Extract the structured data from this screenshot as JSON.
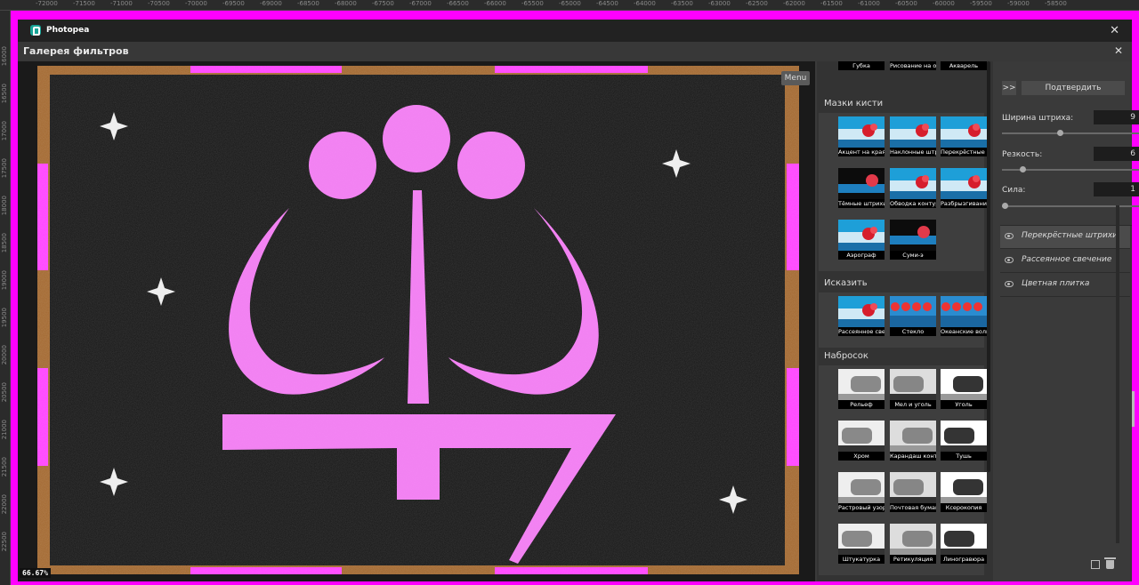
{
  "app": {
    "title": "Photopea",
    "logo_icon": "photopea-logo-icon"
  },
  "ruler": {
    "top_ticks": [
      "-72000",
      "-71500",
      "-71000",
      "-70500",
      "-70000",
      "-69500",
      "-69000",
      "-68500",
      "-68000",
      "-67500",
      "-67000",
      "-66500",
      "-66000",
      "-65500",
      "-65000",
      "-64500",
      "-64000",
      "-63500",
      "-63000",
      "-62500",
      "-62000",
      "-61500",
      "-61000",
      "-60500",
      "-60000",
      "-59500",
      "-59000",
      "-58500"
    ],
    "left_ticks": [
      "16000",
      "16500",
      "17000",
      "17500",
      "18000",
      "18500",
      "19000",
      "19500",
      "20000",
      "20500",
      "21000",
      "21500",
      "22000",
      "22500"
    ]
  },
  "dialog": {
    "title": "Галерея фильтров",
    "close_icon": "close-icon"
  },
  "preview": {
    "menu_label": "Menu",
    "zoom": "66.67%"
  },
  "library": {
    "top_row": [
      "Губка",
      "Рисование на обороте",
      "Акварель"
    ],
    "sections": [
      {
        "title": "Мазки кисти",
        "items": [
          "Акцент на краях",
          "Наклонные штрихи",
          "Перекрёстные штрихи",
          "Тёмные штрихи",
          "Обводка контура",
          "Разбрызгивание",
          "Аэрограф",
          "Суми-э"
        ]
      },
      {
        "title": "Исказить",
        "items": [
          "Рассеянное свечение",
          "Стекло",
          "Океанские волны"
        ]
      },
      {
        "title": "Набросок",
        "items": [
          "Рельеф",
          "Мел и уголь",
          "Уголь",
          "Хром",
          "Карандаш контур",
          "Тушь",
          "Растровый узор",
          "Почтовая бумага",
          "Ксерокопия",
          "Штукатурка",
          "Ретикуляция",
          "Линогравюра"
        ]
      }
    ]
  },
  "settings": {
    "expand_label": ">>",
    "confirm_label": "Подтвердить",
    "params": [
      {
        "label": "Ширина штриха:",
        "value": "9",
        "fraction": 0.44
      },
      {
        "label": "Резкость:",
        "value": "6",
        "fraction": 0.14
      },
      {
        "label": "Сила:",
        "value": "1",
        "fraction": 0.0
      }
    ],
    "layers": [
      {
        "name": "Перекрёстные штрихи",
        "active": true,
        "icon": "eye-icon"
      },
      {
        "name": "Рассеянное свечение",
        "active": false,
        "icon": "eye-icon"
      },
      {
        "name": "Цветная плитка",
        "active": false,
        "icon": "eye-icon"
      }
    ],
    "new_layer_icon": "new-layer-icon",
    "delete_icon": "trash-icon"
  },
  "colors": {
    "accent": "#ff00ff",
    "artwork_pink": "#f27ef2",
    "frame": "#a0642a",
    "logo": "#18a497"
  }
}
